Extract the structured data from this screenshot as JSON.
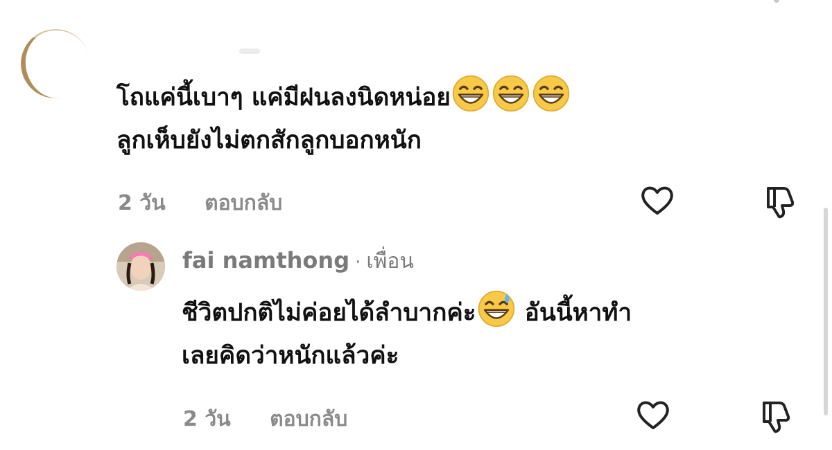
{
  "comments": [
    {
      "author": "",
      "text_line1_a": "โถแค่นี้เบาๆ แค่มีฝนลงนิดหน่อย",
      "text_line1_emoji": "grinning-face-with-smiling-eyes",
      "text_line2": "ลูกเห็บยังไม่ตกสักลูกบอกหนัก",
      "time": "2 วัน",
      "reply_label": "ตอบกลับ"
    }
  ],
  "reply": {
    "author": "fai namthong",
    "separator": "·",
    "badge": "เพื่อน",
    "text_line1_a": "ชีวิตปกติไม่ค่อยได้ลำบากค่ะ",
    "text_line1_emoji": "grinning-face-with-sweat",
    "text_line1_b": "อันนี้หาทำ",
    "text_line2": "เลยคิดว่าหนักแล้วค่ะ",
    "time": "2 วัน",
    "reply_label": "ตอบกลับ"
  },
  "icons": {
    "like": "heart-icon",
    "dislike": "thumbs-down-icon"
  },
  "colors": {
    "text": "#111111",
    "meta": "#8a8a8a",
    "emoji_face": "#f7c948",
    "sweat": "#5fb4f2"
  }
}
